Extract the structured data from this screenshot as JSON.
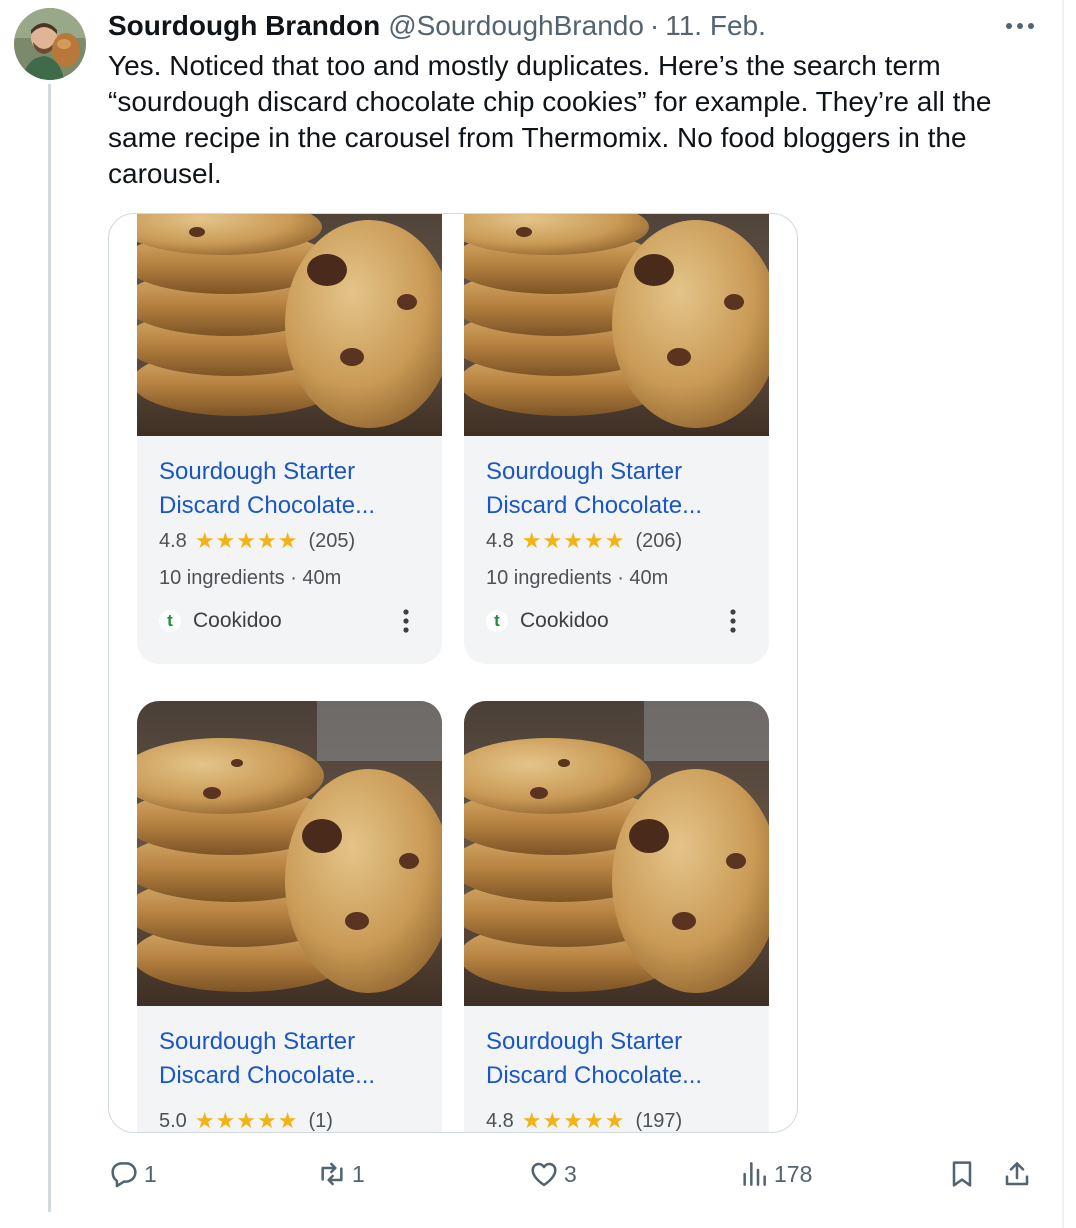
{
  "tweet": {
    "author_name": "Sourdough Brandon",
    "handle": "@SourdoughBrando",
    "separator": "·",
    "date": "11. Feb.",
    "text": "Yes. Noticed that too and mostly duplicates. Here’s the search term “sourdough discard chocolate chip cookies” for example. They’re all the same recipe in the carousel from Thermomix. No food bloggers in the carousel."
  },
  "cards": [
    {
      "title_line1": "Sourdough Starter",
      "title_line2": "Discard Chocolate...",
      "rating": "4.8",
      "stars": "★★★★★",
      "reviews": "(205)",
      "meta": "10 ingredients · 40m",
      "source": "Cookidoo",
      "favicon": "t"
    },
    {
      "title_line1": "Sourdough Starter",
      "title_line2": "Discard Chocolate...",
      "rating": "4.8",
      "stars": "★★★★★",
      "reviews": "(206)",
      "meta": "10 ingredients · 40m",
      "source": "Cookidoo",
      "favicon": "t"
    },
    {
      "title_line1": "Sourdough Starter",
      "title_line2": "Discard Chocolate...",
      "rating": "5.0",
      "stars": "★★★★★",
      "reviews": "(1)"
    },
    {
      "title_line1": "Sourdough Starter",
      "title_line2": "Discard Chocolate...",
      "rating": "4.8",
      "stars": "★★★★★",
      "reviews": "(197)"
    }
  ],
  "actions": {
    "replies": "1",
    "reposts": "1",
    "likes": "3",
    "views": "178"
  },
  "colors": {
    "link_blue": "#1a56c8",
    "star_gold": "#f2b318",
    "muted_text": "#536471",
    "card_bg": "#f3f4f6",
    "cookidoo_green": "#1e8e3e"
  },
  "icons": [
    "more-icon",
    "reply-icon",
    "repost-icon",
    "like-icon",
    "views-icon",
    "bookmark-icon",
    "share-icon",
    "cookidoo-favicon",
    "card-more-icon"
  ]
}
